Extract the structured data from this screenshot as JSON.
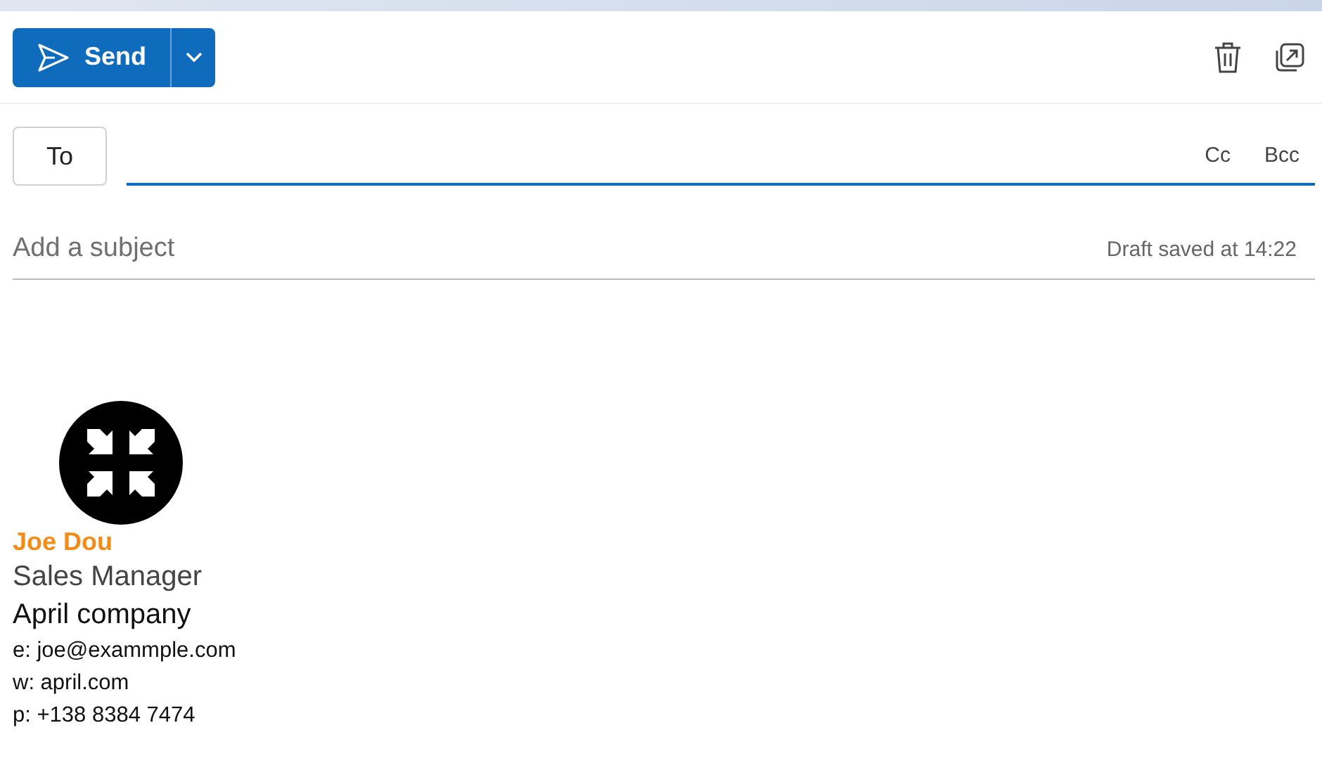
{
  "toolbar": {
    "send_label": "Send"
  },
  "recipients": {
    "to_label": "To",
    "cc_label": "Cc",
    "bcc_label": "Bcc"
  },
  "subject": {
    "placeholder": "Add a subject",
    "status": "Draft saved at 14:22"
  },
  "signature": {
    "name": "Joe Dou",
    "title": "Sales Manager",
    "company": "April company",
    "contacts": [
      "e: joe@exammple.com",
      "w: april.com",
      "p: +138 8384 7474"
    ]
  }
}
